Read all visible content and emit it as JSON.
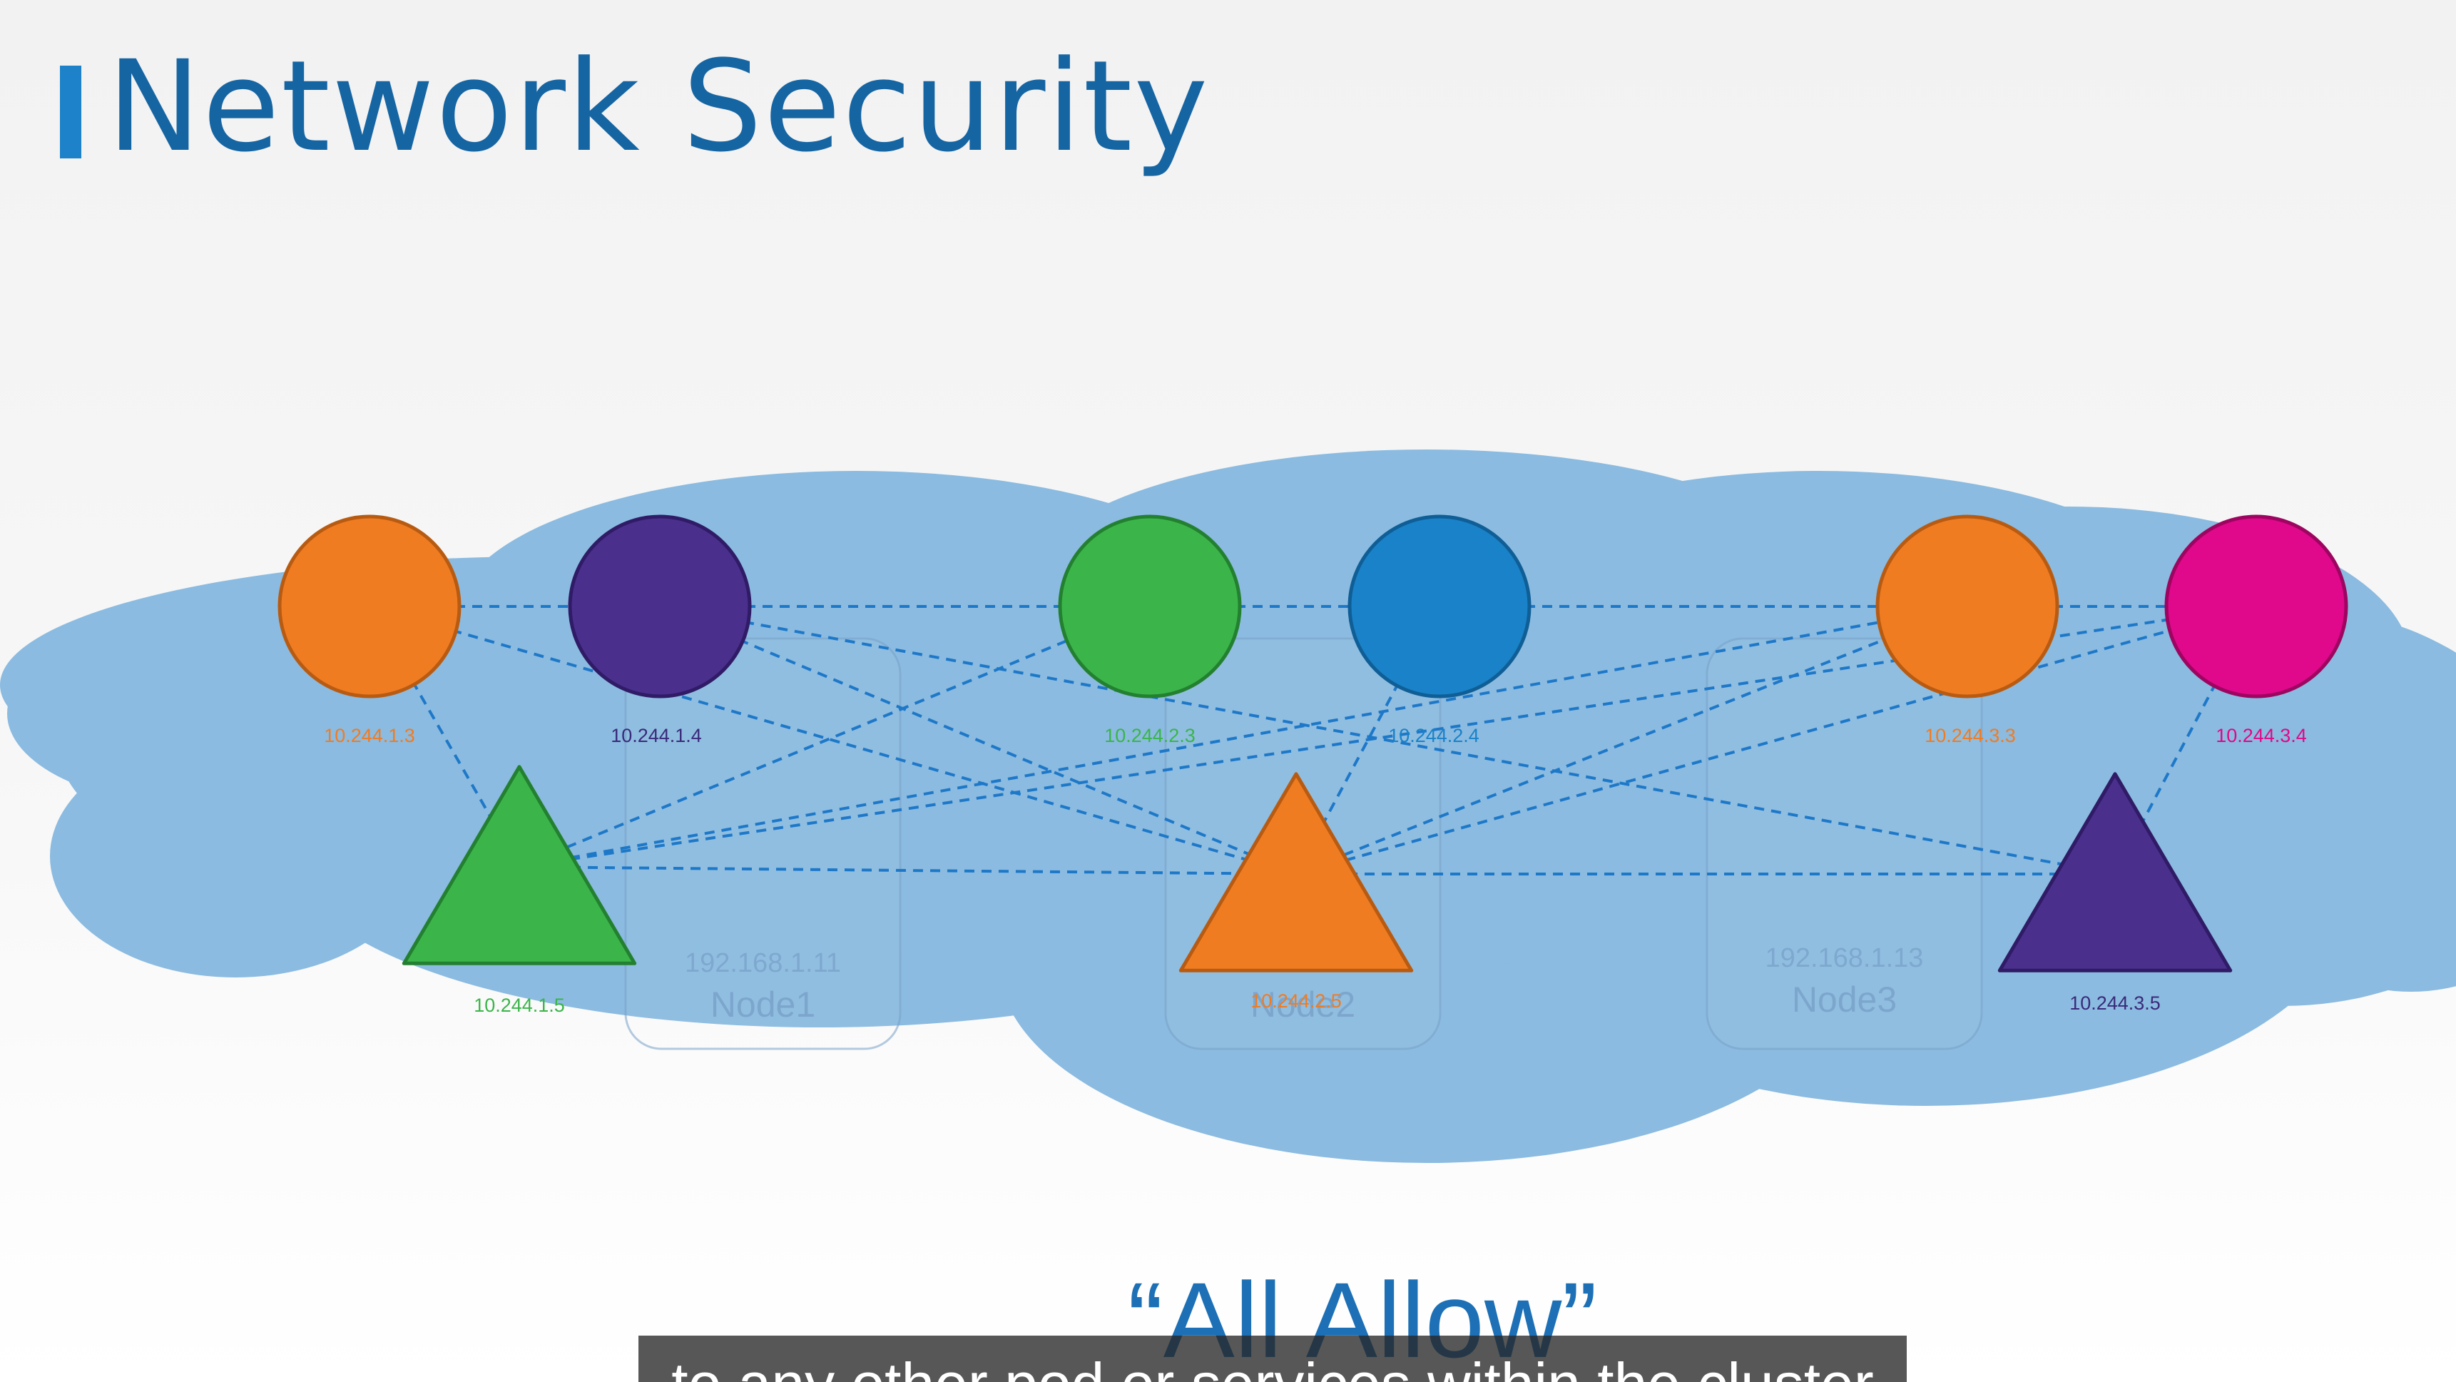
{
  "title": "Network Security",
  "caption": "“All Allow”",
  "subtitle": "to any other pod or services within the cluster",
  "colors": {
    "title": "#1665a3",
    "accent_bar": "#1d82c9",
    "cloud": "#8bbbe0",
    "link_line": "#1e78c8",
    "orange": "#f07c22",
    "purple": "#4a2f8c",
    "green": "#3bb54a",
    "blue": "#1a82c8",
    "magenta": "#e0088b"
  },
  "nodes": [
    {
      "ip": "192.168.1.11",
      "name": "Node1"
    },
    {
      "ip": "",
      "name": "Node2"
    },
    {
      "ip": "192.168.1.13",
      "name": "Node3"
    }
  ],
  "pods": [
    {
      "id": "p1",
      "shape": "circle",
      "color": "orange",
      "ip": "10.244.1.3"
    },
    {
      "id": "p2",
      "shape": "circle",
      "color": "purple",
      "ip": "10.244.1.4"
    },
    {
      "id": "p3",
      "shape": "triangle",
      "color": "green",
      "ip": "10.244.1.5"
    },
    {
      "id": "p4",
      "shape": "circle",
      "color": "green",
      "ip": "10.244.2.3"
    },
    {
      "id": "p5",
      "shape": "circle",
      "color": "blue",
      "ip": "10.244.2.4"
    },
    {
      "id": "p6",
      "shape": "triangle",
      "color": "orange",
      "ip": "10.244.2.5"
    },
    {
      "id": "p7",
      "shape": "circle",
      "color": "orange",
      "ip": "10.244.3.3"
    },
    {
      "id": "p8",
      "shape": "circle",
      "color": "magenta",
      "ip": "10.244.3.4"
    },
    {
      "id": "p9",
      "shape": "triangle",
      "color": "purple",
      "ip": "10.244.3.5"
    }
  ],
  "links": [
    [
      "p1",
      "p2"
    ],
    [
      "p2",
      "p4"
    ],
    [
      "p4",
      "p5"
    ],
    [
      "p5",
      "p7"
    ],
    [
      "p7",
      "p8"
    ],
    [
      "p1",
      "p3"
    ],
    [
      "p1",
      "p6"
    ],
    [
      "p2",
      "p6"
    ],
    [
      "p2",
      "p9"
    ],
    [
      "p3",
      "p4"
    ],
    [
      "p3",
      "p6"
    ],
    [
      "p3",
      "p7"
    ],
    [
      "p3",
      "p8"
    ],
    [
      "p5",
      "p6"
    ],
    [
      "p6",
      "p7"
    ],
    [
      "p6",
      "p9"
    ],
    [
      "p8",
      "p9"
    ],
    [
      "p6",
      "p8"
    ]
  ]
}
